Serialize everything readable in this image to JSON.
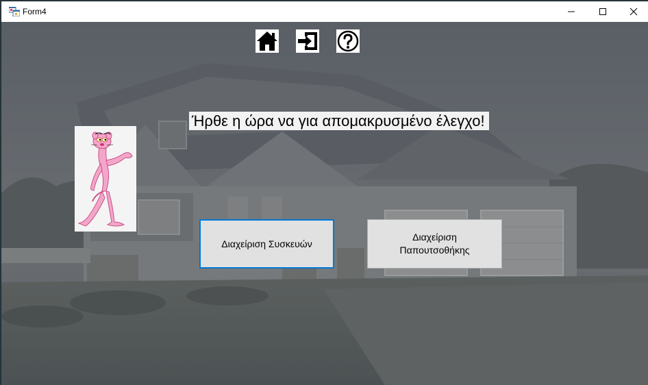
{
  "window": {
    "title": "Form4",
    "controls": {
      "minimize": "minimize",
      "maximize": "maximize",
      "close": "close"
    }
  },
  "toolbar": {
    "icons": [
      "home-icon",
      "exit-icon",
      "help-icon"
    ]
  },
  "main": {
    "heading": "Ήρθε η ώρα να για απομακρυσμένο έλεγχο!",
    "buttons": {
      "devices": "Διαχείριση Συσκευών",
      "shoe_rack": "Διαχείριση\nΠαπουτσοθήκης"
    }
  },
  "colors": {
    "focus_border": "#0078d7",
    "button_bg": "#e1e1e1",
    "heading_bg": "#f2f2f2",
    "panther_pink": "#f4a6c8"
  }
}
